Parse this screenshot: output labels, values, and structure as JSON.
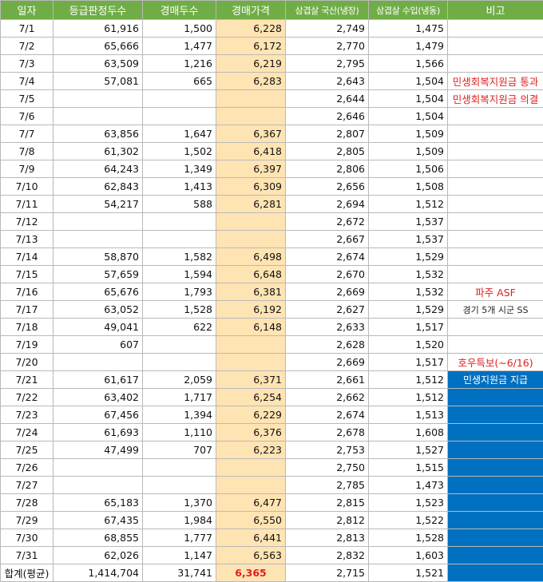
{
  "headers": [
    "일자",
    "등급판정두수",
    "경매두수",
    "경매가격",
    "삼겹살 국산(냉장)",
    "삼겹살 수입(냉동)",
    "비고"
  ],
  "rows": [
    {
      "date": "7/1",
      "grade": "61,916",
      "auction": "1,500",
      "price": "6,228",
      "domestic": "2,749",
      "imported": "1,475",
      "note": "",
      "holiday": false,
      "note_style": ""
    },
    {
      "date": "7/2",
      "grade": "65,666",
      "auction": "1,477",
      "price": "6,172",
      "domestic": "2,770",
      "imported": "1,479",
      "note": "",
      "holiday": false,
      "note_style": ""
    },
    {
      "date": "7/3",
      "grade": "63,509",
      "auction": "1,216",
      "price": "6,219",
      "domestic": "2,795",
      "imported": "1,566",
      "note": "",
      "holiday": false,
      "note_style": ""
    },
    {
      "date": "7/4",
      "grade": "57,081",
      "auction": "665",
      "price": "6,283",
      "domestic": "2,643",
      "imported": "1,504",
      "note": "민생회복지원금 통과",
      "holiday": false,
      "note_style": "red"
    },
    {
      "date": "7/5",
      "grade": "",
      "auction": "",
      "price": "",
      "domestic": "2,644",
      "imported": "1,504",
      "note": "민생회복지원금 의결",
      "holiday": true,
      "note_style": "red"
    },
    {
      "date": "7/6",
      "grade": "",
      "auction": "",
      "price": "",
      "domestic": "2,646",
      "imported": "1,504",
      "note": "",
      "holiday": true,
      "note_style": ""
    },
    {
      "date": "7/7",
      "grade": "63,856",
      "auction": "1,647",
      "price": "6,367",
      "domestic": "2,807",
      "imported": "1,509",
      "note": "",
      "holiday": false,
      "note_style": ""
    },
    {
      "date": "7/8",
      "grade": "61,302",
      "auction": "1,502",
      "price": "6,418",
      "domestic": "2,805",
      "imported": "1,509",
      "note": "",
      "holiday": false,
      "note_style": ""
    },
    {
      "date": "7/9",
      "grade": "64,243",
      "auction": "1,349",
      "price": "6,397",
      "domestic": "2,806",
      "imported": "1,506",
      "note": "",
      "holiday": false,
      "note_style": ""
    },
    {
      "date": "7/10",
      "grade": "62,843",
      "auction": "1,413",
      "price": "6,309",
      "domestic": "2,656",
      "imported": "1,508",
      "note": "",
      "holiday": false,
      "note_style": ""
    },
    {
      "date": "7/11",
      "grade": "54,217",
      "auction": "588",
      "price": "6,281",
      "domestic": "2,694",
      "imported": "1,512",
      "note": "",
      "holiday": false,
      "note_style": ""
    },
    {
      "date": "7/12",
      "grade": "",
      "auction": "",
      "price": "",
      "domestic": "2,672",
      "imported": "1,537",
      "note": "",
      "holiday": true,
      "note_style": ""
    },
    {
      "date": "7/13",
      "grade": "",
      "auction": "",
      "price": "",
      "domestic": "2,667",
      "imported": "1,537",
      "note": "",
      "holiday": true,
      "note_style": ""
    },
    {
      "date": "7/14",
      "grade": "58,870",
      "auction": "1,582",
      "price": "6,498",
      "domestic": "2,674",
      "imported": "1,529",
      "note": "",
      "holiday": false,
      "note_style": ""
    },
    {
      "date": "7/15",
      "grade": "57,659",
      "auction": "1,594",
      "price": "6,648",
      "domestic": "2,670",
      "imported": "1,532",
      "note": "",
      "holiday": false,
      "note_style": ""
    },
    {
      "date": "7/16",
      "grade": "65,676",
      "auction": "1,793",
      "price": "6,381",
      "domestic": "2,669",
      "imported": "1,532",
      "note": "파주 ASF",
      "holiday": false,
      "note_style": "red"
    },
    {
      "date": "7/17",
      "grade": "63,052",
      "auction": "1,528",
      "price": "6,192",
      "domestic": "2,627",
      "imported": "1,529",
      "note": "경기 5개 시군 SS",
      "holiday": false,
      "note_style": "dark"
    },
    {
      "date": "7/18",
      "grade": "49,041",
      "auction": "622",
      "price": "6,148",
      "domestic": "2,633",
      "imported": "1,517",
      "note": "",
      "holiday": false,
      "note_style": ""
    },
    {
      "date": "7/19",
      "grade": "607",
      "auction": "",
      "price": "",
      "domestic": "2,628",
      "imported": "1,520",
      "note": "",
      "holiday": true,
      "note_style": ""
    },
    {
      "date": "7/20",
      "grade": "",
      "auction": "",
      "price": "",
      "domestic": "2,669",
      "imported": "1,517",
      "note": "호우특보(~6/16)",
      "holiday": true,
      "note_style": "red"
    },
    {
      "date": "7/21",
      "grade": "61,617",
      "auction": "2,059",
      "price": "6,371",
      "domestic": "2,661",
      "imported": "1,512",
      "note": "민생지원금 지급",
      "holiday": false,
      "note_style": "blue"
    },
    {
      "date": "7/22",
      "grade": "63,402",
      "auction": "1,717",
      "price": "6,254",
      "domestic": "2,662",
      "imported": "1,512",
      "note": "",
      "holiday": false,
      "note_style": "blue"
    },
    {
      "date": "7/23",
      "grade": "67,456",
      "auction": "1,394",
      "price": "6,229",
      "domestic": "2,674",
      "imported": "1,513",
      "note": "",
      "holiday": false,
      "note_style": "blue"
    },
    {
      "date": "7/24",
      "grade": "61,693",
      "auction": "1,110",
      "price": "6,376",
      "domestic": "2,678",
      "imported": "1,608",
      "note": "",
      "holiday": false,
      "note_style": "blue"
    },
    {
      "date": "7/25",
      "grade": "47,499",
      "auction": "707",
      "price": "6,223",
      "domestic": "2,753",
      "imported": "1,527",
      "note": "",
      "holiday": false,
      "note_style": "blue"
    },
    {
      "date": "7/26",
      "grade": "",
      "auction": "",
      "price": "",
      "domestic": "2,750",
      "imported": "1,515",
      "note": "",
      "holiday": true,
      "note_style": "blue"
    },
    {
      "date": "7/27",
      "grade": "",
      "auction": "",
      "price": "",
      "domestic": "2,785",
      "imported": "1,473",
      "note": "",
      "holiday": true,
      "note_style": "blue"
    },
    {
      "date": "7/28",
      "grade": "65,183",
      "auction": "1,370",
      "price": "6,477",
      "domestic": "2,815",
      "imported": "1,523",
      "note": "",
      "holiday": false,
      "note_style": "blue"
    },
    {
      "date": "7/29",
      "grade": "67,435",
      "auction": "1,984",
      "price": "6,550",
      "domestic": "2,812",
      "imported": "1,522",
      "note": "",
      "holiday": false,
      "note_style": "blue"
    },
    {
      "date": "7/30",
      "grade": "68,855",
      "auction": "1,777",
      "price": "6,441",
      "domestic": "2,813",
      "imported": "1,528",
      "note": "",
      "holiday": false,
      "note_style": "blue"
    },
    {
      "date": "7/31",
      "grade": "62,026",
      "auction": "1,147",
      "price": "6,563",
      "domestic": "2,832",
      "imported": "1,603",
      "note": "",
      "holiday": false,
      "note_style": "blue"
    }
  ],
  "total": {
    "label": "합계(평균)",
    "grade": "1,414,704",
    "auction": "31,741",
    "price": "6,365",
    "domestic": "2,715",
    "imported": "1,521",
    "note": ""
  },
  "colors": {
    "header": "#70ad47",
    "price_fill": "#ffe4b3",
    "holiday_text": "#e02020",
    "note_blue": "#0070c0"
  }
}
